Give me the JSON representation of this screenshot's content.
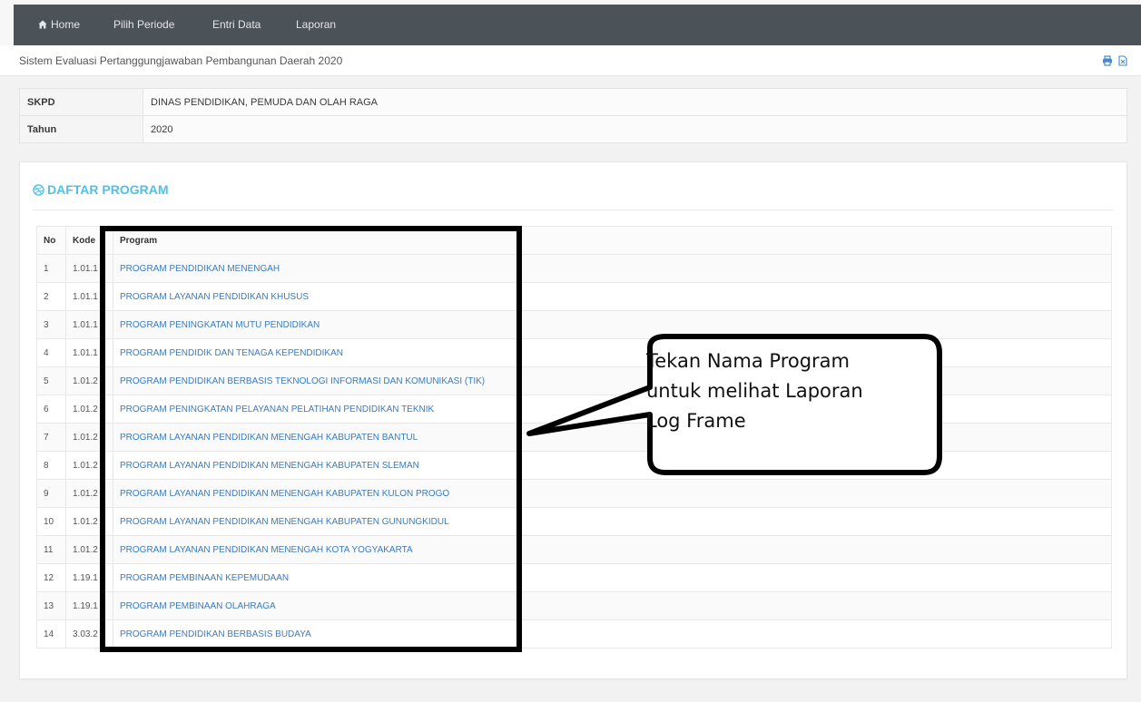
{
  "nav": {
    "home": "Home",
    "pilih_periode": "Pilih Periode",
    "entri_data": "Entri Data",
    "laporan": "Laporan"
  },
  "header": {
    "title": "Sistem Evaluasi Pertanggungjawaban Pembangunan Daerah 2020",
    "tools": [
      "print-icon",
      "file-export-icon"
    ]
  },
  "info": {
    "skpd_label": "SKPD",
    "skpd_value": "DINAS PENDIDIKAN, PEMUDA DAN OLAH RAGA",
    "tahun_label": "Tahun",
    "tahun_value": "2020"
  },
  "panel": {
    "title": "DAFTAR PROGRAM",
    "icon": "dribbble-icon"
  },
  "table": {
    "headers": {
      "no": "No",
      "kode": "Kode",
      "program": "Program"
    },
    "rows": [
      {
        "no": "1",
        "kode": "1.01.1",
        "program": "PROGRAM PENDIDIKAN MENENGAH"
      },
      {
        "no": "2",
        "kode": "1.01.1",
        "program": "PROGRAM LAYANAN PENDIDIKAN KHUSUS"
      },
      {
        "no": "3",
        "kode": "1.01.1",
        "program": "PROGRAM PENINGKATAN MUTU PENDIDIKAN"
      },
      {
        "no": "4",
        "kode": "1.01.1",
        "program": "PROGRAM PENDIDIK DAN TENAGA KEPENDIDIKAN"
      },
      {
        "no": "5",
        "kode": "1.01.2",
        "program": "PROGRAM PENDIDIKAN BERBASIS TEKNOLOGI INFORMASI DAN KOMUNIKASI (TIK)"
      },
      {
        "no": "6",
        "kode": "1.01.2",
        "program": "PROGRAM PENINGKATAN PELAYANAN PELATIHAN PENDIDIKAN TEKNIK"
      },
      {
        "no": "7",
        "kode": "1.01.2",
        "program": "PROGRAM LAYANAN PENDIDIKAN MENENGAH KABUPATEN BANTUL"
      },
      {
        "no": "8",
        "kode": "1.01.2",
        "program": "PROGRAM LAYANAN PENDIDIKAN MENENGAH KABUPATEN SLEMAN"
      },
      {
        "no": "9",
        "kode": "1.01.2",
        "program": "PROGRAM LAYANAN PENDIDIKAN MENENGAH KABUPATEN KULON PROGO"
      },
      {
        "no": "10",
        "kode": "1.01.2",
        "program": "PROGRAM LAYANAN PENDIDIKAN MENENGAH KABUPATEN GUNUNGKIDUL"
      },
      {
        "no": "11",
        "kode": "1.01.2",
        "program": "PROGRAM LAYANAN PENDIDIKAN MENENGAH KOTA YOGYAKARTA"
      },
      {
        "no": "12",
        "kode": "1.19.1",
        "program": "PROGRAM PEMBINAAN KEPEMUDAAN"
      },
      {
        "no": "13",
        "kode": "1.19.1",
        "program": "PROGRAM PEMBINAAN OLAHRAGA"
      },
      {
        "no": "14",
        "kode": "3.03.2",
        "program": "PROGRAM PENDIDIKAN BERBASIS BUDAYA"
      }
    ]
  },
  "annotation": {
    "line1": "Tekan Nama Program",
    "line2": "untuk melihat Laporan",
    "line3": "Log Frame"
  },
  "colors": {
    "navbar": "#4b5258",
    "accent": "#4fc0e8",
    "link": "#3b7bbd"
  }
}
